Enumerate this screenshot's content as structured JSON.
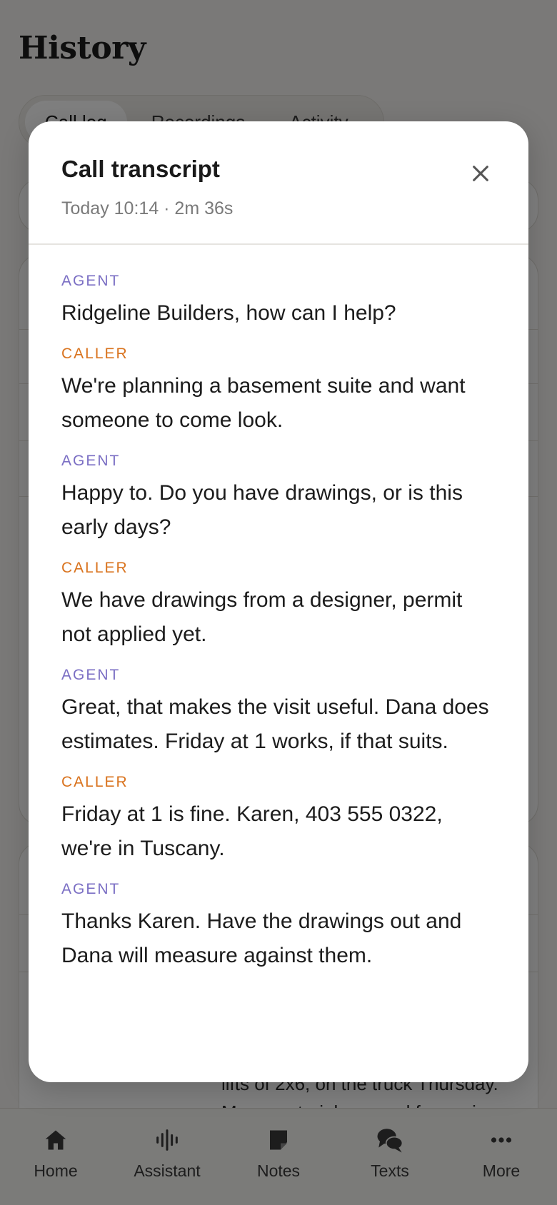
{
  "background": {
    "page_title": "History",
    "tabs": [
      {
        "label": "Call log"
      },
      {
        "label": "Recordings"
      },
      {
        "label": "Activity"
      }
    ],
    "snippet_line_1": "lifts of 2x6, on the truck Thursday.",
    "snippet_line_2": "Move materials around for easier"
  },
  "modal": {
    "title": "Call transcript",
    "subtitle": "Today 10:14 · 2m 36s",
    "close_icon": "close-icon",
    "turns": [
      {
        "speaker": "AGENT",
        "role": "agent",
        "text": "Ridgeline Builders, how can I help?"
      },
      {
        "speaker": "CALLER",
        "role": "caller",
        "text": "We're planning a basement suite and want someone to come look."
      },
      {
        "speaker": "AGENT",
        "role": "agent",
        "text": "Happy to. Do you have drawings, or is this early days?"
      },
      {
        "speaker": "CALLER",
        "role": "caller",
        "text": "We have drawings from a designer, permit not applied yet."
      },
      {
        "speaker": "AGENT",
        "role": "agent",
        "text": "Great, that makes the visit useful. Dana does estimates. Friday at 1 works, if that suits."
      },
      {
        "speaker": "CALLER",
        "role": "caller",
        "text": "Friday at 1 is fine. Karen, 403 555 0322, we're in Tuscany."
      },
      {
        "speaker": "AGENT",
        "role": "agent",
        "text": "Thanks Karen. Have the drawings out and Dana will measure against them."
      }
    ]
  },
  "nav": {
    "items": [
      {
        "label": "Home",
        "icon": "home-icon"
      },
      {
        "label": "Assistant",
        "icon": "waveform-icon"
      },
      {
        "label": "Notes",
        "icon": "note-icon"
      },
      {
        "label": "Texts",
        "icon": "chat-bubbles-icon"
      },
      {
        "label": "More",
        "icon": "more-dots-icon"
      }
    ]
  },
  "colors": {
    "agent_label": "#7b6fc4",
    "caller_label": "#d9731e",
    "scrim": "rgba(0,0,0,0.5)"
  }
}
